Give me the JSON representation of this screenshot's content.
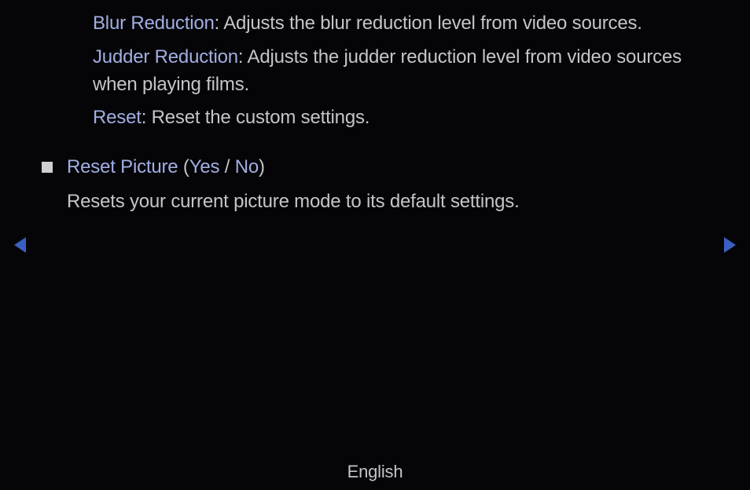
{
  "sub_items": {
    "blur": {
      "term": "Blur Reduction",
      "desc": ": Adjusts the blur reduction level from video sources."
    },
    "judder": {
      "term": "Judder Reduction",
      "desc": ": Adjusts the judder reduction level from video sources when playing films."
    },
    "reset": {
      "term": "Reset",
      "desc": ": Reset the custom settings."
    }
  },
  "main": {
    "heading": "Reset Picture",
    "paren_open": " (",
    "opt_yes": "Yes",
    "sep": " / ",
    "opt_no": "No",
    "paren_close": ")",
    "body": "Resets your current picture mode to its default settings."
  },
  "footer": {
    "language": "English"
  }
}
